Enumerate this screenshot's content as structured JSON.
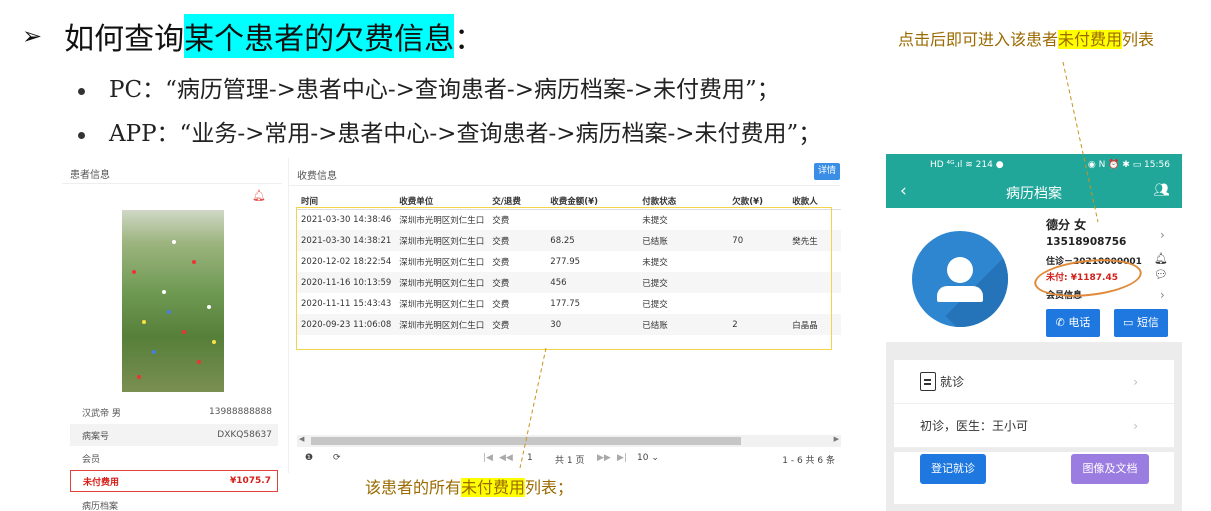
{
  "heading": {
    "arrow": "➢",
    "prefix": "如何查询",
    "highlight": "某个患者的欠费信息",
    "suffix": "："
  },
  "bullets": [
    "PC：“病历管理->患者中心->查询患者->病历档案->未付费用”；",
    "APP：“业务->常用->患者中心->查询患者->病历档案->未付费用”；"
  ],
  "note_top": {
    "before": "点击后即可进入该患者",
    "mark": "未付费用",
    "after": "列表"
  },
  "note_bottom": {
    "before": "该患者的所有",
    "mark": "未付费用",
    "after": "列表；"
  },
  "pc_patient": {
    "header": "患者信息",
    "bell_icon": "bell-icon",
    "rows": [
      {
        "label": "汉武帝 男",
        "value": "13988888888"
      },
      {
        "label": "病案号",
        "value": "DXKQ58637"
      },
      {
        "label": "会员",
        "value": ""
      },
      {
        "label": "未付费用",
        "value": "¥1075.7"
      },
      {
        "label": "病历档案",
        "value": ""
      }
    ]
  },
  "pc_fees": {
    "header": "收费信息",
    "detail_button": "详情",
    "columns": [
      "时间",
      "收费单位",
      "交/退费",
      "收费金额(¥)",
      "付款状态",
      "欠款(¥)",
      "收款人"
    ],
    "rows": [
      [
        "2021-03-30 14:38:46",
        "深圳市光明区刘仁生口",
        "交费",
        "",
        "未提交",
        "",
        ""
      ],
      [
        "2021-03-30 14:38:21",
        "深圳市光明区刘仁生口",
        "交费",
        "68.25",
        "已结账",
        "70",
        "樊先生"
      ],
      [
        "2020-12-02 18:22:54",
        "深圳市光明区刘仁生口",
        "交费",
        "277.95",
        "未提交",
        "",
        ""
      ],
      [
        "2020-11-16 10:13:59",
        "深圳市光明区刘仁生口",
        "交费",
        "456",
        "已提交",
        "",
        ""
      ],
      [
        "2020-11-11 15:43:43",
        "深圳市光明区刘仁生口",
        "交费",
        "177.75",
        "已提交",
        "",
        ""
      ],
      [
        "2020-09-23 11:06:08",
        "深圳市光明区刘仁生口",
        "交费",
        "30",
        "已结账",
        "2",
        "白晶晶"
      ]
    ],
    "pager": {
      "current_page": "1",
      "total_pages": "共 1 页",
      "page_size": "10 ⌄",
      "summary": "1 - 6 共 6 条"
    }
  },
  "app": {
    "status_left": "HD ⁴ᴳ.ıl ≋ 214 ●",
    "status_right": "◉ N ⏰ ✱ ▭ 15:56",
    "title": "病历档案",
    "patient_name": "德分 女",
    "phone": "13518908756",
    "record_no": "住诊－20210000001",
    "unpaid": "未付: ¥1187.45",
    "member": "会员信息",
    "sms_button": "短信",
    "call_button": "电话",
    "visit_label": "就诊",
    "visit_detail": "初诊，医生：王小可",
    "register_button": "登记就诊",
    "image_button": "图像及文档",
    "accent": "#20a79a"
  }
}
